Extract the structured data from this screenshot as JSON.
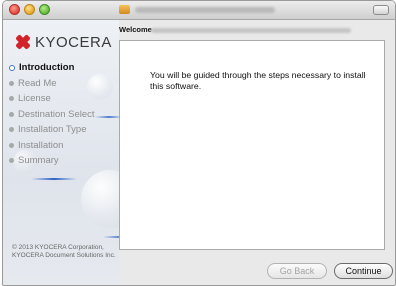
{
  "window": {
    "traffic_lights": [
      {
        "name": "close",
        "color": "#e0443a"
      },
      {
        "name": "minimize",
        "color": "#e6a526"
      },
      {
        "name": "zoom",
        "color": "#5fb93c"
      }
    ],
    "title_icon": "package-icon"
  },
  "sidebar": {
    "logo_text": "KYOCERA",
    "logo_color": "#d2232a",
    "steps": [
      {
        "label": "Introduction",
        "active": true
      },
      {
        "label": "Read Me",
        "active": false
      },
      {
        "label": "License",
        "active": false
      },
      {
        "label": "Destination Select",
        "active": false
      },
      {
        "label": "Installation Type",
        "active": false
      },
      {
        "label": "Installation",
        "active": false
      },
      {
        "label": "Summary",
        "active": false
      }
    ],
    "copyright_line1": "© 2013 KYOCERA Corporation,",
    "copyright_line2": "KYOCERA Document Solutions Inc."
  },
  "main": {
    "heading": "Welcome",
    "body_text": "You will be guided through the steps necessary to install this software."
  },
  "buttons": {
    "back_label": "Go Back",
    "continue_label": "Continue"
  },
  "colors": {
    "active_step": "#3d78c9",
    "brand_red": "#d2232a"
  }
}
